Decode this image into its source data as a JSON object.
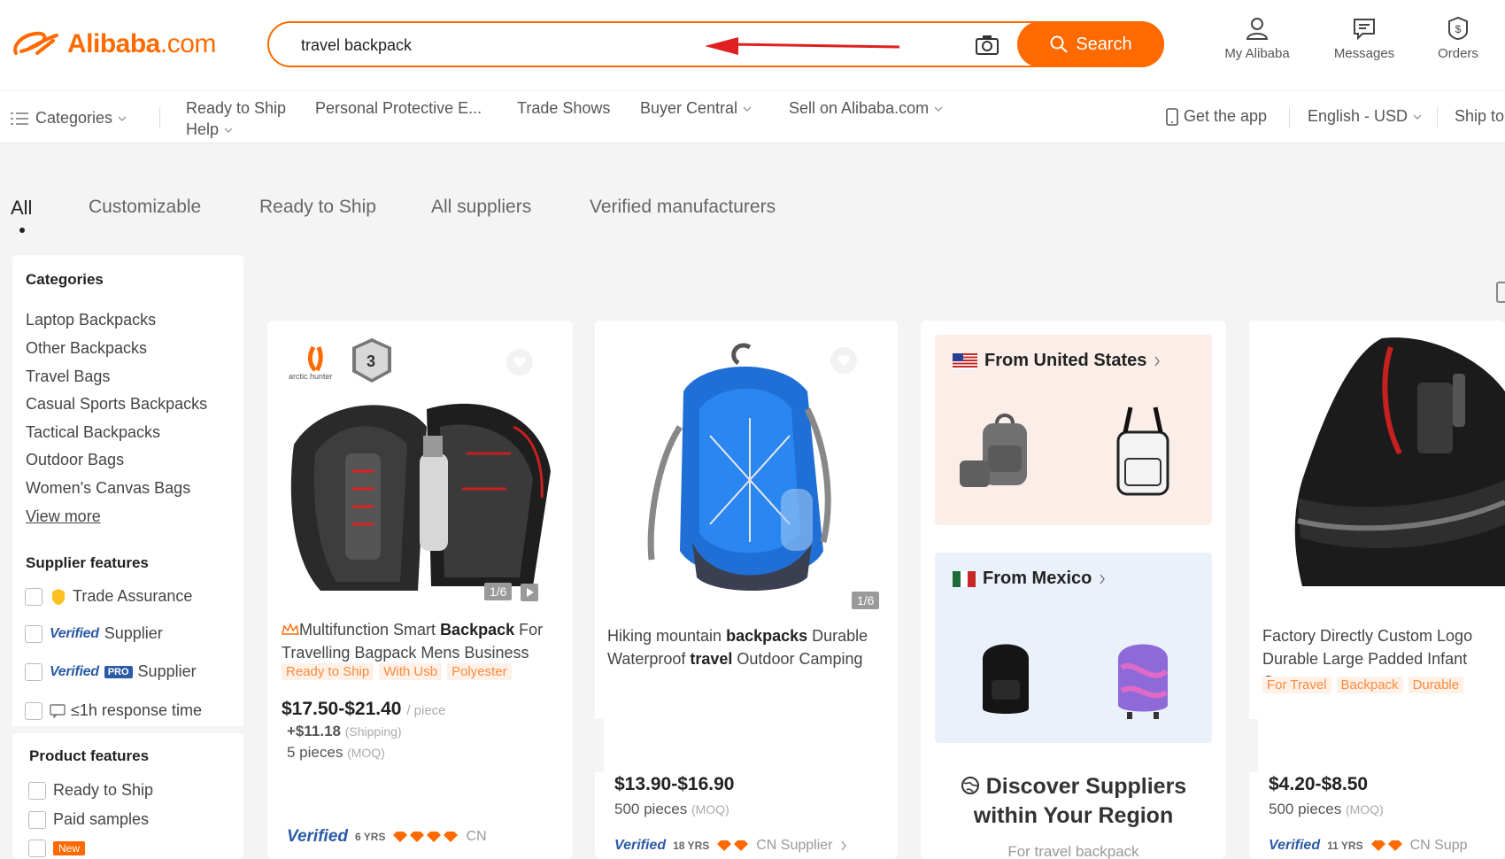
{
  "header": {
    "logo_text": "Alibaba",
    "logo_suffix": ".com",
    "search": {
      "value": "travel backpack",
      "button_label": "Search"
    },
    "actions": [
      {
        "label": "My Alibaba",
        "icon": "user-icon"
      },
      {
        "label": "Messages",
        "icon": "message-icon"
      },
      {
        "label": "Orders",
        "icon": "orders-icon"
      }
    ]
  },
  "navbar": {
    "categories_label": "Categories",
    "links": [
      "Ready to Ship",
      "Personal Protective E...",
      "Trade Shows",
      "Buyer Central",
      "Sell on Alibaba.com"
    ],
    "help_label": "Help",
    "get_app": "Get the app",
    "language": "English - USD",
    "ship_to": "Ship to"
  },
  "tabs": [
    "All",
    "Customizable",
    "Ready to Ship",
    "All suppliers",
    "Verified manufacturers"
  ],
  "sidebar": {
    "categories_title": "Categories",
    "categories": [
      "Laptop Backpacks",
      "Other Backpacks",
      "Travel Bags",
      "Casual Sports Backpacks",
      "Tactical Backpacks",
      "Outdoor Bags",
      "Women's Canvas Bags"
    ],
    "view_more": "View more",
    "supplier_features_title": "Supplier features",
    "supplier_features": {
      "trade_assurance": "Trade Assurance",
      "verified_logo": "Verified",
      "verified_supplier": "Supplier",
      "pro_badge": "PRO",
      "verified_pro_supplier": "Supplier",
      "response_time": "≤1h response time"
    },
    "product_features_title": "Product features",
    "product_features": [
      "Ready to Ship",
      "Paid samples",
      "New"
    ]
  },
  "cards": [
    {
      "brand": "arctic hunter",
      "image_counter": "1/6",
      "title_pre": "Multifunction Smart ",
      "title_bold": "Backpack",
      "title_post": " For Travelling Bagpack Mens Business",
      "tags": [
        "Ready to Ship",
        "With Usb",
        "Polyester"
      ],
      "price": "$17.50-$21.40",
      "price_unit": "/ piece",
      "shipping": "+$11.18",
      "shipping_note": "(Shipping)",
      "moq": "5 pieces",
      "moq_note": "(MOQ)",
      "verified": "Verified",
      "years": "6 YRS",
      "country": "CN"
    },
    {
      "image_counter": "1/6",
      "title_pre": "Hiking mountain ",
      "title_bold": "backpacks",
      "title_mid": " Durable Waterproof ",
      "title_bold2": "travel",
      "title_post": " Outdoor Camping",
      "price": "$13.90-$16.90",
      "moq": "500 pieces",
      "moq_note": "(MOQ)",
      "verified": "Verified",
      "years": "18 YRS",
      "country": "CN Supplier"
    },
    {
      "region1": "From United States",
      "region2": "From Mexico",
      "discover_line1": "Discover Suppliers",
      "discover_line2": "within Your Region",
      "discover_sub": "For travel backpack"
    },
    {
      "title": "Factory Directly Custom Logo Durable Large Padded Infant Car",
      "tags": [
        "For Travel",
        "Backpack",
        "Durable"
      ],
      "price": "$4.20-$8.50",
      "moq": "500 pieces",
      "moq_note": "(MOQ)",
      "verified": "Verified",
      "years": "11 YRS",
      "country": "CN Supp"
    }
  ],
  "colors": {
    "brand": "#ff6a00",
    "verified": "#2b5aa6",
    "tag_text": "#ff8a3d"
  }
}
